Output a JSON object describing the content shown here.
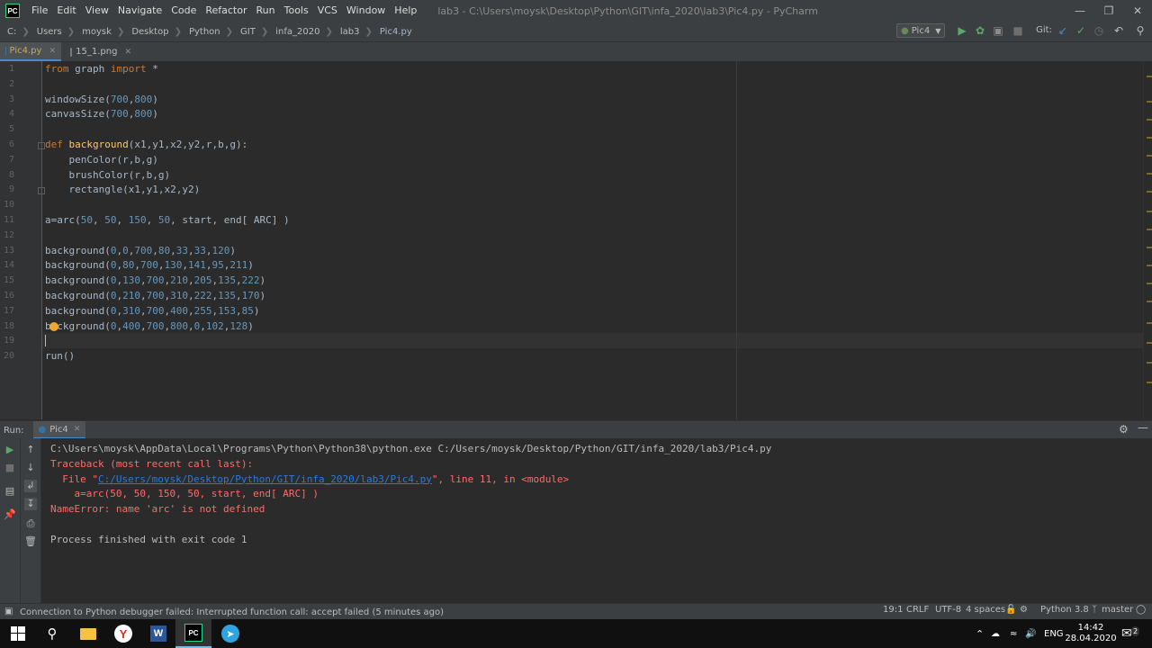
{
  "titlebar": {
    "menu": [
      "File",
      "Edit",
      "View",
      "Navigate",
      "Code",
      "Refactor",
      "Run",
      "Tools",
      "VCS",
      "Window",
      "Help"
    ],
    "window_title": "lab3 - C:\\Users\\moysk\\Desktop\\Python\\GIT\\infa_2020\\lab3\\Pic4.py - PyCharm",
    "logo_text": "PC"
  },
  "navbar": {
    "breadcrumbs": [
      "C:",
      "Users",
      "moysk",
      "Desktop",
      "Python",
      "GIT",
      "infa_2020",
      "lab3",
      "Pic4.py"
    ],
    "run_config": "Pic4",
    "git_label": "Git:"
  },
  "tabs": [
    {
      "label": "Pic4.py"
    },
    {
      "label": "15_1.png"
    }
  ],
  "editor": {
    "line_numbers": [
      "1",
      "2",
      "3",
      "4",
      "5",
      "6",
      "7",
      "8",
      "9",
      "10",
      "11",
      "12",
      "13",
      "14",
      "15",
      "16",
      "17",
      "18",
      "19",
      "20"
    ],
    "lines": [
      "from graph import *",
      "",
      "windowSize(700,800)",
      "canvasSize(700,800)",
      "",
      "def background(x1,y1,x2,y2,r,b,g):",
      "    penColor(r,b,g)",
      "    brushColor(r,b,g)",
      "    rectangle(x1,y1,x2,y2)",
      "",
      "a=arc(50, 50, 150, 50, start, end[ ARC] )",
      "",
      "background(0,0,700,80,33,33,120)",
      "background(0,80,700,130,141,95,211)",
      "background(0,130,700,210,205,135,222)",
      "background(0,210,700,310,222,135,170)",
      "background(0,310,700,400,255,153,85)",
      "background(0,400,700,800,0,102,128)",
      "",
      "run()"
    ]
  },
  "run_panel": {
    "label": "Run:",
    "tab": "Pic4",
    "output": [
      {
        "text": "C:\\Users\\moysk\\AppData\\Local\\Programs\\Python\\Python38\\python.exe C:/Users/moysk/Desktop/Python/GIT/infa_2020/lab3/Pic4.py",
        "style": "plain"
      },
      {
        "text": "Traceback (most recent call last):",
        "style": "err"
      },
      {
        "text": "  File \"",
        "style": "err",
        "link": "C:/Users/moysk/Desktop/Python/GIT/infa_2020/lab3/Pic4.py",
        "suffix": "\", line 11, in <module>"
      },
      {
        "text": "    a=arc(50, 50, 150, 50, start, end[ ARC] )",
        "style": "err"
      },
      {
        "text": "NameError: name 'arc' is not defined",
        "style": "err"
      },
      {
        "text": "",
        "style": "plain"
      },
      {
        "text": "Process finished with exit code 1",
        "style": "plain"
      }
    ]
  },
  "statusbar": {
    "message": "Connection to Python debugger failed: Interrupted function call: accept failed (5 minutes ago)",
    "position": "19:1",
    "line_sep": "CRLF",
    "encoding": "UTF-8",
    "indent": "4 spaces",
    "interpreter": "Python 3.8",
    "branch": "master"
  },
  "taskbar": {
    "lang": "ENG",
    "time": "14:42",
    "date": "28.04.2020",
    "notif_count": "2"
  }
}
